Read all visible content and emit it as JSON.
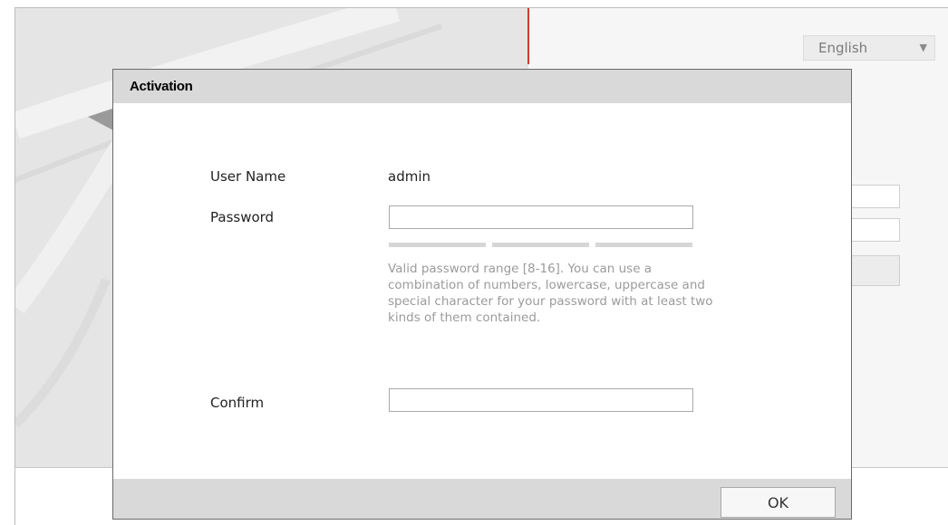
{
  "language": {
    "selected": "English"
  },
  "dialog": {
    "title": "Activation",
    "fields": {
      "user_name_label": "User Name",
      "user_name_value": "admin",
      "password_label": "Password",
      "password_value": "",
      "confirm_label": "Confirm",
      "confirm_value": ""
    },
    "password_hint": "Valid password range [8-16]. You can use a combination of numbers, lowercase, uppercase and special character for your password with at least two kinds of them contained.",
    "ok_label": "OK"
  },
  "colors": {
    "divider_accent": "#d03a3a",
    "header_bg": "#d9d9d9",
    "hint_text": "#9b9b9b"
  }
}
